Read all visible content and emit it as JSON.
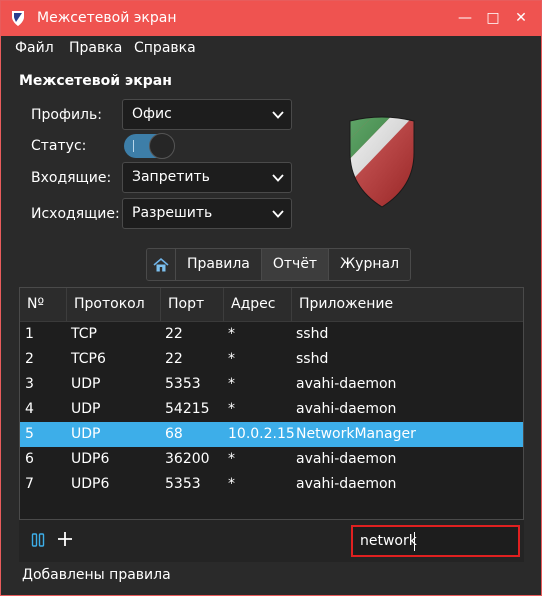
{
  "window": {
    "title": "Межсетевой экран",
    "buttons": {
      "minimize": "—",
      "maximize": "□",
      "close": "✕"
    }
  },
  "menu": [
    "Файл",
    "Правка",
    "Справка"
  ],
  "section_title": "Межсетевой экран",
  "form": {
    "profile_label": "Профиль:",
    "profile_value": "Офис",
    "status_label": "Статус:",
    "status_on": true,
    "incoming_label": "Входящие:",
    "incoming_value": "Запретить",
    "outgoing_label": "Исходящие:",
    "outgoing_value": "Разрешить"
  },
  "tabs": [
    "Правила",
    "Отчёт",
    "Журнал"
  ],
  "active_tab": "Отчёт",
  "table": {
    "headers": [
      "Nº",
      "Протокол",
      "Порт",
      "Адрес",
      "Приложение"
    ],
    "rows": [
      [
        "1",
        "TCP",
        "22",
        "*",
        "sshd"
      ],
      [
        "2",
        "TCP6",
        "22",
        "*",
        "sshd"
      ],
      [
        "3",
        "UDP",
        "5353",
        "*",
        "avahi-daemon"
      ],
      [
        "4",
        "UDP",
        "54215",
        "*",
        "avahi-daemon"
      ],
      [
        "5",
        "UDP",
        "68",
        "10.0.2.15",
        "NetworkManager"
      ],
      [
        "6",
        "UDP6",
        "36200",
        "*",
        "avahi-daemon"
      ],
      [
        "7",
        "UDP6",
        "5353",
        "*",
        "avahi-daemon"
      ]
    ],
    "selected_row": 4
  },
  "search": {
    "value": "network"
  },
  "status_text": "Добавлены правила",
  "colors": {
    "accent": "#3daee9",
    "titlebar": "#ef5350",
    "highlight_border": "#e02020"
  },
  "icons": [
    "app-shield-icon",
    "chevron-down-icon",
    "home-icon",
    "pause-icon",
    "plus-icon",
    "gufw-shield-logo"
  ]
}
